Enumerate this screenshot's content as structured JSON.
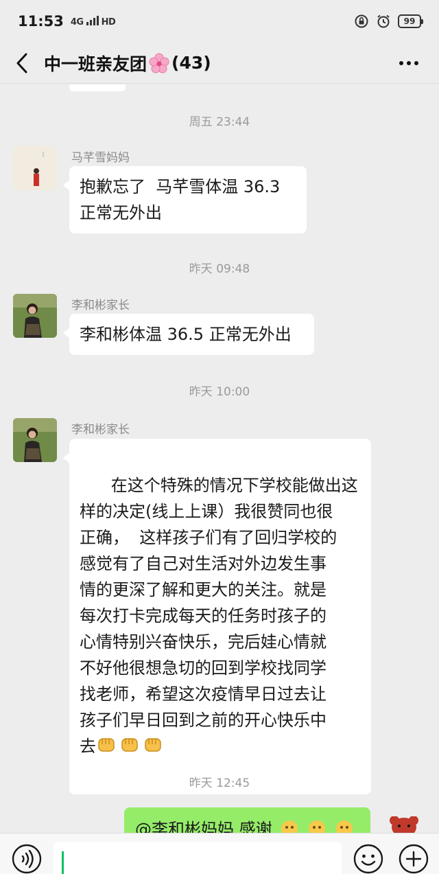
{
  "status_bar": {
    "time": "11:53",
    "network": "4G",
    "hd": "HD",
    "battery": "99"
  },
  "nav": {
    "title": "中一班亲友团",
    "count": "(43)"
  },
  "messages": [
    {
      "type": "timestamp",
      "text": "周五 23:44"
    },
    {
      "type": "message",
      "sender": "马芊雪妈妈",
      "text": "抱歉忘了  马芊雪体温 36.3\n正常无外出"
    },
    {
      "type": "timestamp",
      "text": "昨天 09:48"
    },
    {
      "type": "message",
      "sender": "李和彬家长",
      "text": "李和彬体温 36.5 正常无外出"
    },
    {
      "type": "timestamp",
      "text": "昨天 10:00"
    },
    {
      "type": "message",
      "sender": "李和彬家长",
      "text": "在这个特殊的情况下学校能做出这\n样的决定(线上上课）我很赞同也很\n正确，  这样孩子们有了回归学校的\n感觉有了自己对生活对外边发生事\n情的更深了解和更大的关注。就是\n每次打卡完成每天的任务时孩子的\n心情特别兴奋快乐，完后娃心情就\n不好他很想急切的回到学校找同学\n找老师，希望这次疫情早日过去让\n孩子们早日回到之前的开心快乐中\n去"
    },
    {
      "type": "timestamp",
      "text": "昨天 12:45"
    },
    {
      "type": "mine",
      "text": "@李和彬妈妈  感谢"
    }
  ],
  "colors": {
    "background": "#ededed",
    "bubble_other": "#ffffff",
    "bubble_mine": "#95ec69",
    "accent": "#07c160"
  }
}
